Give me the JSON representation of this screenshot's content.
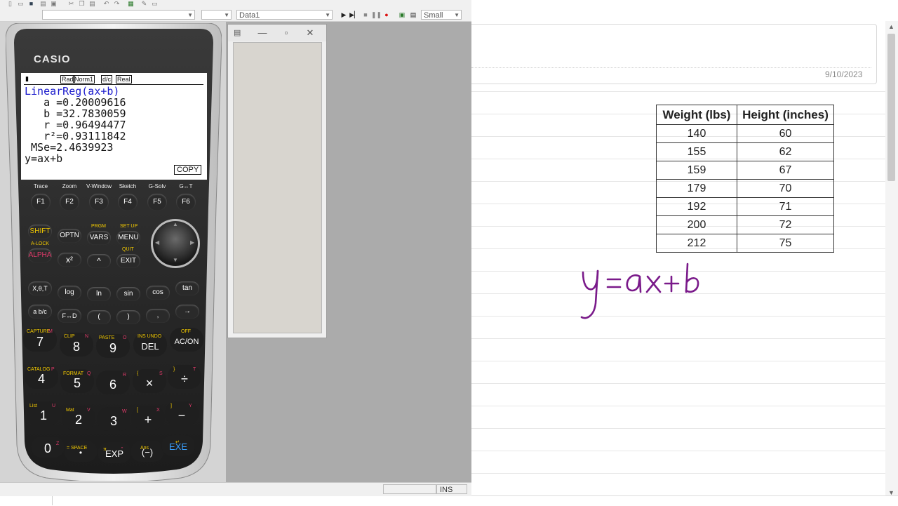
{
  "emulator": {
    "toolbar": {
      "data_combo": "Data1",
      "size_combo": "Small",
      "icons": [
        "new-icon",
        "open-icon",
        "save-icon",
        "print-icon",
        "settings-icon",
        "cut-icon",
        "copy-icon",
        "paste-icon",
        "undo-icon",
        "redo-icon",
        "capture-icon",
        "tool-icon",
        "help-icon",
        "play-icon",
        "step-icon",
        "stop-icon",
        "pause-icon",
        "record-icon"
      ]
    },
    "status": {
      "mode": "INS"
    },
    "mini_window": {
      "buttons": [
        "minimize",
        "maximize",
        "close"
      ]
    }
  },
  "calculator": {
    "brand": "CASIO",
    "screen": {
      "status_items": [
        "Rad",
        "Norm1",
        "d/c",
        "Real"
      ],
      "lines": [
        "LinearReg(ax+b)",
        "   a =0.20009616",
        "   b =32.7830059",
        "   r =0.96494477",
        "   r²=0.93111842",
        " MSe=2.4639923",
        "y=ax+b"
      ],
      "copy_label": "COPY"
    },
    "fkey_labels": [
      "Trace",
      "Zoom",
      "V-Window",
      "Sketch",
      "G-Solv",
      "G↔T"
    ],
    "fkeys": [
      "F1",
      "F2",
      "F3",
      "F4",
      "F5",
      "F6"
    ],
    "row2": {
      "shift": "SHIFT",
      "optn": "OPTN",
      "prgm": "PRGM",
      "vars": "VARS",
      "setup": "SET UP",
      "menu": "MENU",
      "alpha": "ALPHA",
      "alock": "A-LOCK",
      "x2": "x²",
      "caret": "^",
      "quit": "QUIT",
      "exit": "EXIT"
    },
    "func_keys": [
      "X,θ,T",
      "log",
      "ln",
      "sin",
      "cos",
      "tan",
      "a b/c",
      "F↔D",
      "(",
      ")",
      ",",
      "→"
    ],
    "digit_keys": [
      {
        "label": "7",
        "sub": "CAPTURE",
        "alpha": "M"
      },
      {
        "label": "8",
        "sub": "CLIP",
        "alpha": "N"
      },
      {
        "label": "9",
        "sub": "PASTE",
        "alpha": "O"
      },
      {
        "label": "DEL",
        "sub": "INS UNDO",
        "alpha": ""
      },
      {
        "label": "AC/ON",
        "sub": "OFF",
        "alpha": ""
      },
      {
        "label": "4",
        "sub": "CATALOG",
        "alpha": "P"
      },
      {
        "label": "5",
        "sub": "FORMAT",
        "alpha": "Q"
      },
      {
        "label": "6",
        "sub": "",
        "alpha": "R"
      },
      {
        "label": "×",
        "sub": "{",
        "alpha": "S"
      },
      {
        "label": "÷",
        "sub": "}",
        "alpha": "T"
      },
      {
        "label": "1",
        "sub": "List",
        "alpha": "U"
      },
      {
        "label": "2",
        "sub": "Mat",
        "alpha": "V"
      },
      {
        "label": "3",
        "sub": "",
        "alpha": "W"
      },
      {
        "label": "+",
        "sub": "[",
        "alpha": "X"
      },
      {
        "label": "−",
        "sub": "]",
        "alpha": "Y"
      },
      {
        "label": "0",
        "sub": "",
        "alpha": "Z"
      },
      {
        "label": "•",
        "sub": "= SPACE",
        "alpha": ""
      },
      {
        "label": "EXP",
        "sub": "π",
        "alpha": "”"
      },
      {
        "label": "(−)",
        "sub": "Ans",
        "alpha": ""
      },
      {
        "label": "EXE",
        "sub": "↵",
        "alpha": ""
      }
    ]
  },
  "notebook": {
    "date": "9/10/2023",
    "table": {
      "headers": [
        "Weight (lbs)",
        "Height (inches)"
      ],
      "rows": [
        [
          "140",
          "60"
        ],
        [
          "155",
          "62"
        ],
        [
          "159",
          "67"
        ],
        [
          "179",
          "70"
        ],
        [
          "192",
          "71"
        ],
        [
          "200",
          "72"
        ],
        [
          "212",
          "75"
        ]
      ]
    },
    "handwriting": "y=ax+b"
  }
}
